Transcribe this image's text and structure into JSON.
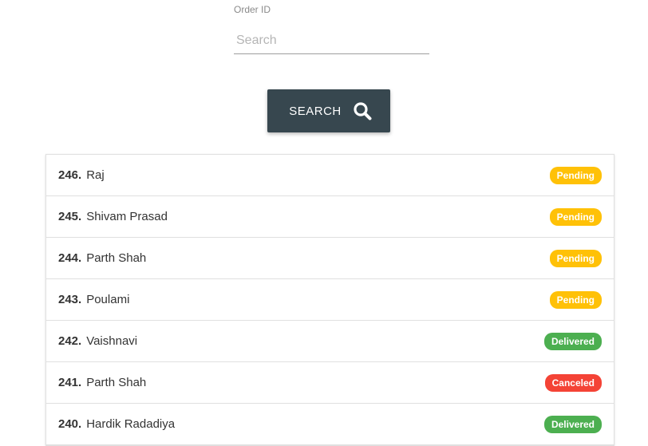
{
  "search": {
    "label": "Order ID",
    "placeholder": "Search",
    "button_label": "SEARCH",
    "button_icon": "search-icon"
  },
  "status_colors": {
    "Pending": "#ffc107",
    "Delivered": "#4caf50",
    "Canceled": "#f44336"
  },
  "orders": [
    {
      "id": "246",
      "name": "Raj",
      "status": "Pending"
    },
    {
      "id": "245",
      "name": "Shivam Prasad",
      "status": "Pending"
    },
    {
      "id": "244",
      "name": "Parth Shah",
      "status": "Pending"
    },
    {
      "id": "243",
      "name": "Poulami",
      "status": "Pending"
    },
    {
      "id": "242",
      "name": "Vaishnavi",
      "status": "Delivered"
    },
    {
      "id": "241",
      "name": "Parth Shah",
      "status": "Canceled"
    },
    {
      "id": "240",
      "name": "Hardik Radadiya",
      "status": "Delivered"
    }
  ]
}
